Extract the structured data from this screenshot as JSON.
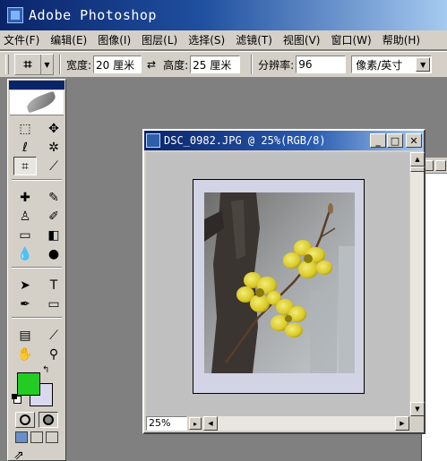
{
  "app": {
    "title": "Adobe Photoshop"
  },
  "menu": [
    "文件(F)",
    "编辑(E)",
    "图像(I)",
    "图层(L)",
    "选择(S)",
    "滤镜(T)",
    "视图(V)",
    "窗口(W)",
    "帮助(H)"
  ],
  "options": {
    "width_label": "宽度:",
    "width_value": "20 厘米",
    "swap_glyph": "⇄",
    "height_label": "高度:",
    "height_value": "25 厘米",
    "resolution_label": "分辨率:",
    "resolution_value": "96",
    "unit_value": "像素/英寸"
  },
  "toolbox": {
    "foreground_color": "#22cc22",
    "background_color": "#d8d8ee"
  },
  "document": {
    "title": "DSC_0982.JPG @ 25%(RGB/8)",
    "zoom": "25%"
  },
  "colors": {
    "title_active": "#0a246a",
    "face": "#d4d0c8",
    "frame_fill": "#d3d3e6"
  }
}
